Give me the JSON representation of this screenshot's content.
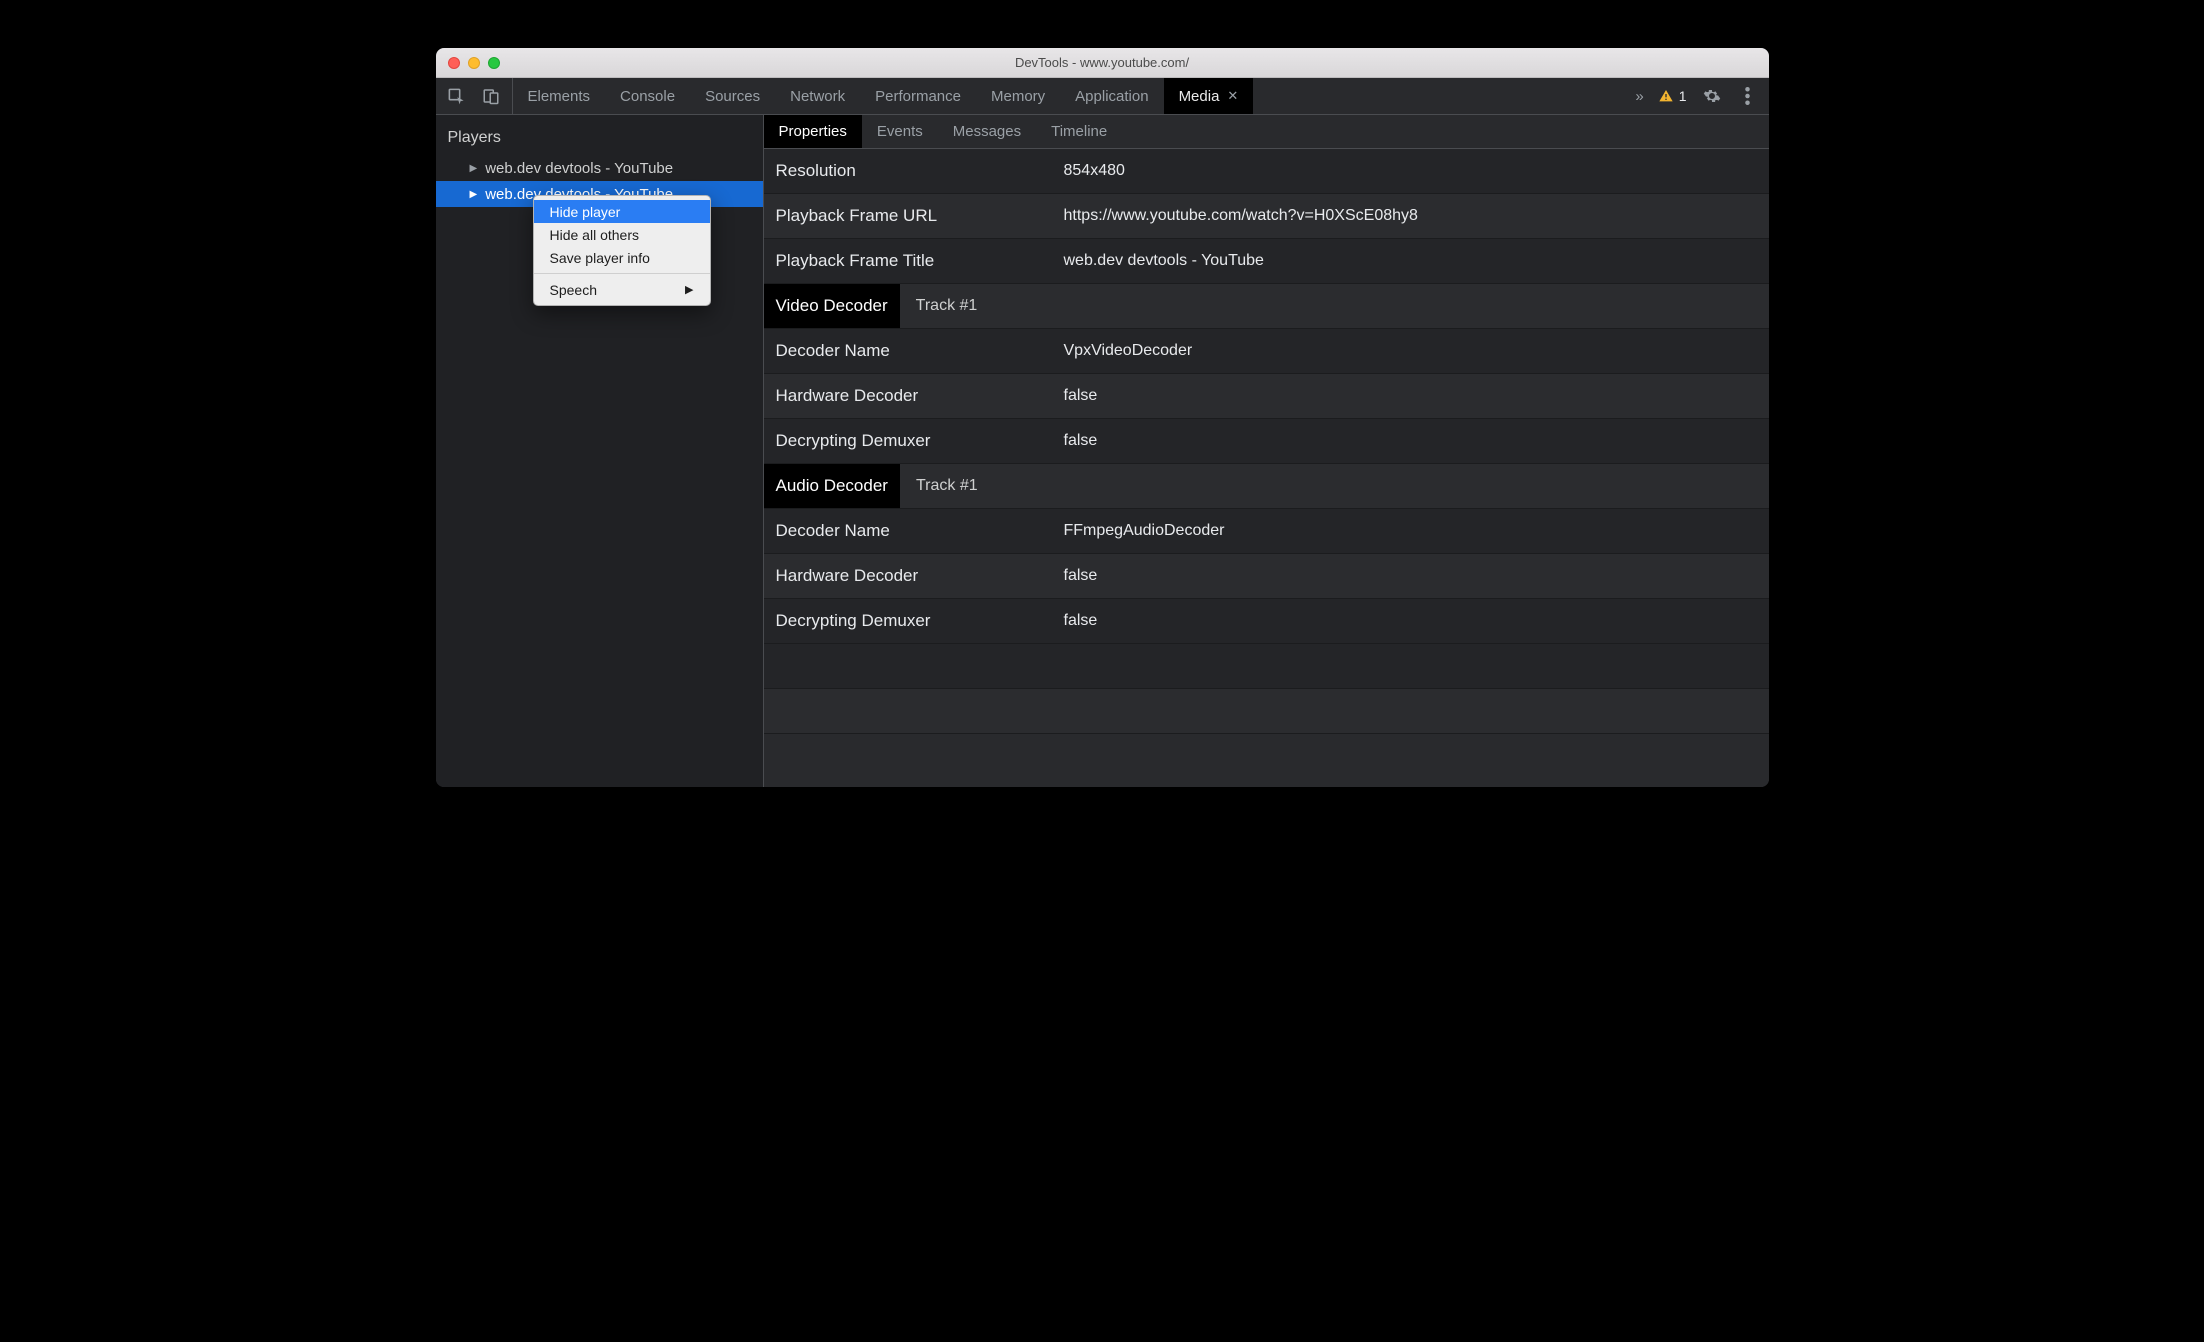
{
  "window": {
    "title": "DevTools - www.youtube.com/"
  },
  "topbar": {
    "tabs": [
      "Elements",
      "Console",
      "Sources",
      "Network",
      "Performance",
      "Memory",
      "Application",
      "Media"
    ],
    "active_tab": "Media",
    "issue_count": "1"
  },
  "sidebar": {
    "header": "Players",
    "items": [
      {
        "label": "web.dev devtools - YouTube"
      },
      {
        "label": "web.dev devtools - YouTube"
      }
    ]
  },
  "context_menu": {
    "items": [
      {
        "label": "Hide player"
      },
      {
        "label": "Hide all others"
      },
      {
        "label": "Save player info"
      }
    ],
    "submenu_label": "Speech"
  },
  "subtabs": {
    "items": [
      "Properties",
      "Events",
      "Messages",
      "Timeline"
    ],
    "active": "Properties"
  },
  "properties": {
    "top": [
      {
        "key": "Resolution",
        "val": "854x480"
      },
      {
        "key": "Playback Frame URL",
        "val": "https://www.youtube.com/watch?v=H0XScE08hy8"
      },
      {
        "key": "Playback Frame Title",
        "val": "web.dev devtools - YouTube"
      }
    ],
    "video_decoder": {
      "title": "Video Decoder",
      "track": "Track #1",
      "rows": [
        {
          "key": "Decoder Name",
          "val": "VpxVideoDecoder"
        },
        {
          "key": "Hardware Decoder",
          "val": "false"
        },
        {
          "key": "Decrypting Demuxer",
          "val": "false"
        }
      ]
    },
    "audio_decoder": {
      "title": "Audio Decoder",
      "track": "Track #1",
      "rows": [
        {
          "key": "Decoder Name",
          "val": "FFmpegAudioDecoder"
        },
        {
          "key": "Hardware Decoder",
          "val": "false"
        },
        {
          "key": "Decrypting Demuxer",
          "val": "false"
        }
      ]
    }
  }
}
